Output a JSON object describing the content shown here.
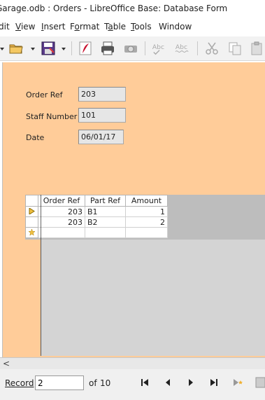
{
  "window": {
    "title": "Garage.odb : Orders - LibreOffice Base: Database Form"
  },
  "menu": [
    {
      "label": "dit",
      "accel": ""
    },
    {
      "label": "View",
      "accel": "V"
    },
    {
      "label": "Insert",
      "accel": "I"
    },
    {
      "label": "Format",
      "accel": "o"
    },
    {
      "label": "Table",
      "accel": "a"
    },
    {
      "label": "Tools",
      "accel": "T"
    },
    {
      "label": "Window",
      "accel": ""
    }
  ],
  "toolbar": {
    "icons": [
      "new-document-dropdown-icon",
      "open-folder-icon",
      "save-icon",
      "export-pdf-icon",
      "print-icon",
      "print-preview-icon",
      "spellcheck-icon",
      "autospellcheck-icon",
      "cut-icon",
      "copy-icon",
      "paste-icon"
    ]
  },
  "form": {
    "order_ref_label": "Order Ref",
    "order_ref_value": "203",
    "staff_number_label": "Staff Number",
    "staff_number_value": "101",
    "date_label": "Date",
    "date_value": "06/01/17",
    "background_color": "#ffcc99"
  },
  "grid": {
    "columns": [
      "Order Ref",
      "Part Ref",
      "Amount"
    ],
    "rows": [
      {
        "order_ref": "203",
        "part_ref": "B1",
        "amount": "1",
        "current": true
      },
      {
        "order_ref": "203",
        "part_ref": "B2",
        "amount": "2",
        "current": false
      }
    ]
  },
  "navigation": {
    "record_label": "Record",
    "record_value": "2",
    "of_label": "of",
    "total": "10"
  }
}
